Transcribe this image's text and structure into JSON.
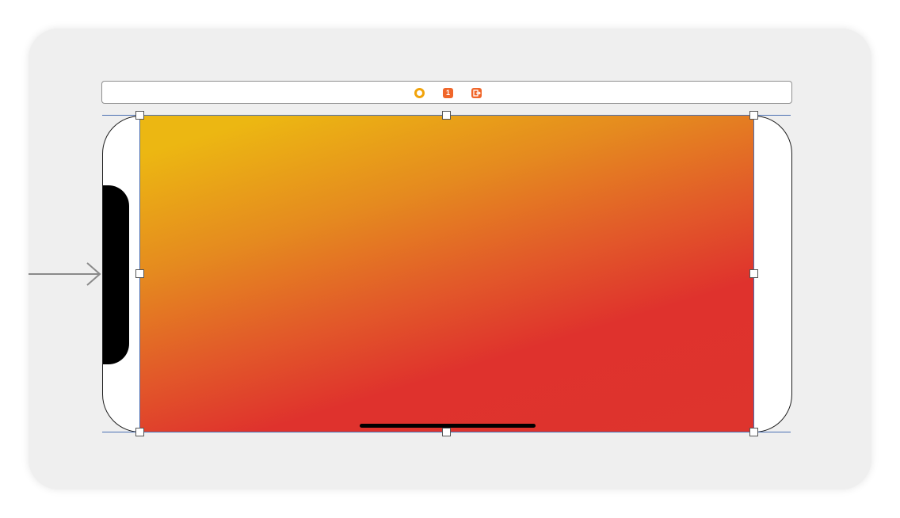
{
  "scene_dock": {
    "icons": [
      {
        "name": "view-controller-icon",
        "color": "#f1a30a"
      },
      {
        "name": "first-responder-icon",
        "label": "1",
        "color": "#f0662a"
      },
      {
        "name": "exit-icon",
        "color": "#f0662a"
      }
    ]
  },
  "canvas": {
    "background": "#efefef",
    "device_orientation": "landscape",
    "selected_view": {
      "type": "gradient-view",
      "colors": [
        "#ecb712",
        "#e58a1f",
        "#e25b29",
        "#df322d"
      ]
    },
    "entry_point_arrow": true
  }
}
